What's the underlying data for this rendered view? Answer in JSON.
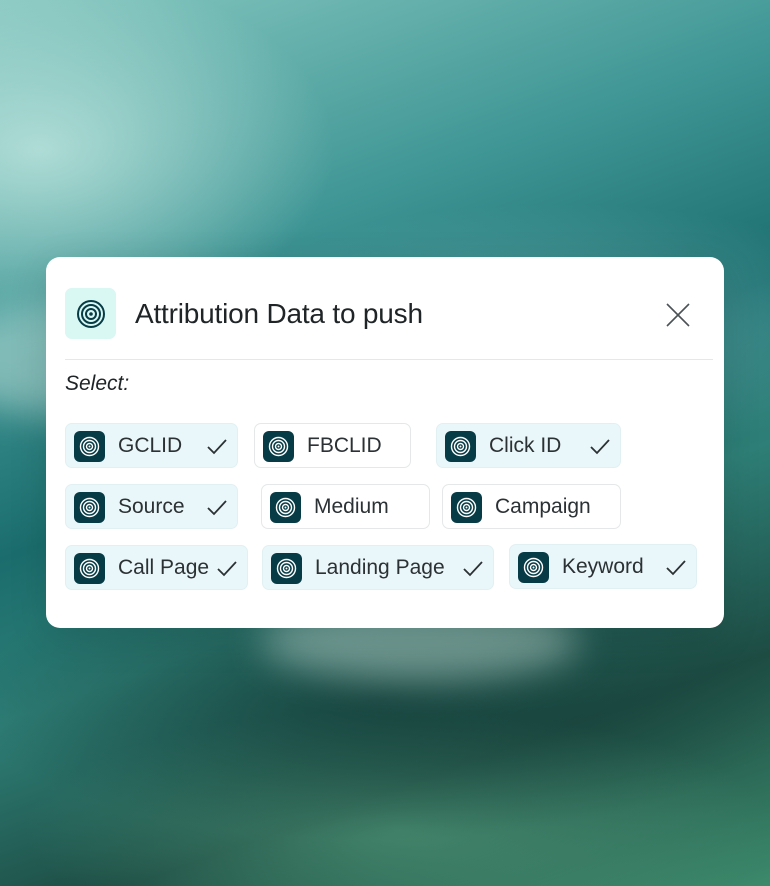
{
  "dialog": {
    "title": "Attribution Data to push",
    "select_label": "Select:",
    "header_icon": "target-icon",
    "close_icon": "close-icon"
  },
  "options": [
    {
      "label": "GCLID",
      "selected": true
    },
    {
      "label": "FBCLID",
      "selected": false
    },
    {
      "label": "Click ID",
      "selected": true
    },
    {
      "label": "Source",
      "selected": true
    },
    {
      "label": "Medium",
      "selected": false
    },
    {
      "label": "Campaign",
      "selected": false
    },
    {
      "label": "Call Page",
      "selected": true
    },
    {
      "label": "Landing Page",
      "selected": true
    },
    {
      "label": "Keyword",
      "selected": true
    }
  ],
  "colors": {
    "accent_dark": "#073c46",
    "icon_bg_light": "#d9f7f3",
    "selected_chip_bg": "#eaf7fa"
  }
}
